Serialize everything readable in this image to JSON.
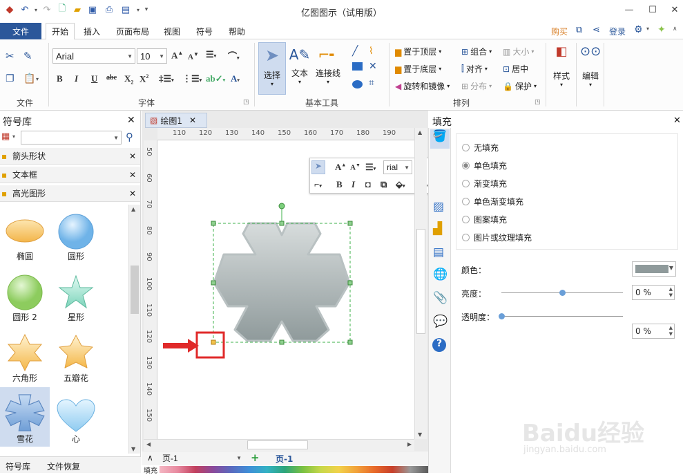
{
  "app": {
    "title": "亿图图示（试用版）",
    "buy": "购买",
    "login": "登录"
  },
  "tabs": {
    "file": "文件",
    "items": [
      "开始",
      "插入",
      "页面布局",
      "视图",
      "符号",
      "帮助"
    ]
  },
  "ribbon": {
    "groups": {
      "file": "文件",
      "font": "字体",
      "tools": "基本工具",
      "arrange": "排列"
    },
    "font_name": "Arial",
    "font_size": "10",
    "tool_select": "选择",
    "tool_text": "文本",
    "tool_connector": "连接线",
    "arrange": {
      "bring_front": "置于顶层",
      "send_back": "置于底层",
      "rotate": "旋转和镜像",
      "group": "组合",
      "align": "对齐",
      "distribute": "分布",
      "size": "大小",
      "center": "居中",
      "protect": "保护"
    },
    "style": "样式",
    "edit": "编辑"
  },
  "library": {
    "title": "符号库",
    "search_placeholder": "",
    "sections": [
      "箭头形状",
      "文本框",
      "高光图形"
    ],
    "shapes": [
      "椭圆",
      "圆形",
      "圆形 2",
      "星形",
      "六角形",
      "五瓣花",
      "雪花",
      "心"
    ],
    "bottom_tabs": [
      "符号库",
      "文件恢复"
    ]
  },
  "document": {
    "tab": "绘图1",
    "ruler_h": [
      "110",
      "120",
      "130",
      "140",
      "150",
      "160",
      "170",
      "180",
      "190"
    ],
    "ruler_v": [
      "50",
      "60",
      "70",
      "80",
      "90",
      "100",
      "110",
      "120",
      "130",
      "140",
      "150"
    ],
    "page_name": "页-1",
    "page_tab": "页-1",
    "fill_label": "填充"
  },
  "floating_toolbar": {
    "font": "rial"
  },
  "fill_panel": {
    "title": "填充",
    "options": [
      "无填充",
      "单色填充",
      "渐变填充",
      "单色渐变填充",
      "图案填充",
      "图片或纹理填充"
    ],
    "selected": "单色填充",
    "color_label": "颜色：",
    "brightness_label": "亮度：",
    "transparency_label": "透明度：",
    "brightness_value": "0 %",
    "transparency_value": "0 %",
    "color_swatch": "#8f9a9b",
    "accent": "#2b579a"
  },
  "watermark": {
    "text": "Baidu经验",
    "url": "jingyan.baidu.com"
  }
}
